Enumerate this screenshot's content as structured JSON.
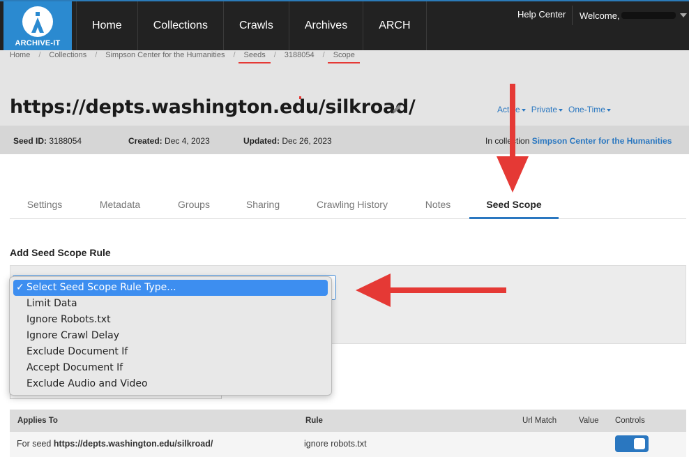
{
  "brand": {
    "logo_text": "ARCHIVE-IT",
    "accent": "#2b8ad0"
  },
  "nav": {
    "items": [
      "Home",
      "Collections",
      "Crawls",
      "Archives",
      "ARCH"
    ]
  },
  "user_menu": {
    "help": "Help Center",
    "welcome": "Welcome,"
  },
  "breadcrumb": [
    "Home",
    "Collections",
    "Simpson Center for the Humanities",
    "Seeds",
    "3188054",
    "Scope"
  ],
  "page": {
    "title": "https://depts.washington.edu/silkroad/",
    "status": [
      "Active",
      "Private",
      "One-Time"
    ]
  },
  "meta": {
    "seed_id_label": "Seed ID:",
    "seed_id": "3188054",
    "created_label": "Created:",
    "created": "Dec 4, 2023",
    "updated_label": "Updated:",
    "updated": "Dec 26, 2023",
    "collection_prefix": "In collection",
    "collection": "Simpson Center for the Humanities"
  },
  "tabs": [
    "Settings",
    "Metadata",
    "Groups",
    "Sharing",
    "Crawling History",
    "Notes",
    "Seed Scope"
  ],
  "form": {
    "section_title": "Add Seed Scope Rule",
    "options": [
      "Select Seed Scope Rule Type...",
      "Limit Data",
      "Ignore Robots.txt",
      "Ignore Crawl Delay",
      "Exclude Document If",
      "Accept Document If",
      "Exclude Audio and Video"
    ],
    "selected_index": 0
  },
  "table": {
    "headers": [
      "Applies To",
      "Rule",
      "Url Match",
      "Value",
      "Controls"
    ],
    "rows": [
      {
        "applies_prefix": "For seed",
        "applies_seed": "https://depts.washington.edu/silkroad/",
        "rule": "ignore robots.txt",
        "toggle_on": true
      }
    ]
  },
  "colors": {
    "link": "#2a77c0",
    "annotation": "#e53935",
    "select_highlight": "#3d8ef0"
  }
}
